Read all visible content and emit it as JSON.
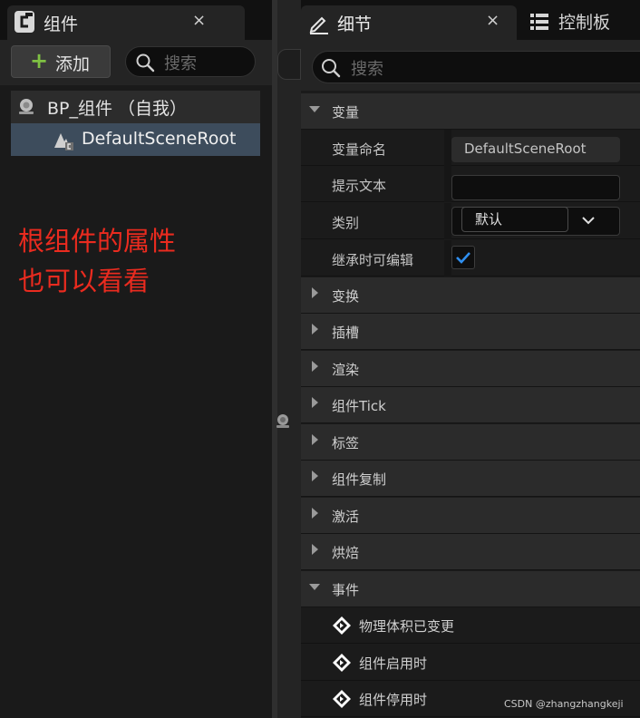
{
  "left_panel": {
    "tab": {
      "title": "组件",
      "close": "×"
    },
    "add_button": {
      "icon": "plus-icon",
      "label": "添加"
    },
    "search": {
      "placeholder": "搜索"
    },
    "tree": {
      "root": {
        "label": "BP_组件 （自我）"
      },
      "child": {
        "label": "DefaultSceneRoot"
      }
    },
    "annotation": {
      "line1": "根组件的属性",
      "line2": "也可以看看",
      "color": "#ea2b1f"
    }
  },
  "details_panel": {
    "tab": {
      "title": "细节",
      "close": "×"
    },
    "dashboard_tab": {
      "title": "控制板"
    },
    "search": {
      "placeholder": "搜索"
    },
    "variables_section": {
      "title": "变量",
      "expanded": true,
      "properties": {
        "variable_name": {
          "label": "变量命名",
          "value": "DefaultSceneRoot"
        },
        "tooltip": {
          "label": "提示文本",
          "value": ""
        },
        "category": {
          "label": "类别",
          "value": "默认"
        },
        "editable_when_inherited": {
          "label": "继承时可编辑",
          "checked": true
        }
      }
    },
    "collapsed_sections": [
      {
        "title": "变换"
      },
      {
        "title": "插槽"
      },
      {
        "title": "渲染"
      },
      {
        "title": "组件Tick"
      },
      {
        "title": "标签"
      },
      {
        "title": "组件复制"
      },
      {
        "title": "激活"
      },
      {
        "title": "烘焙"
      }
    ],
    "events_section": {
      "title": "事件",
      "expanded": true,
      "items": [
        {
          "label": "物理体积已变更"
        },
        {
          "label": "组件启用时"
        },
        {
          "label": "组件停用时"
        }
      ]
    }
  },
  "watermark": "CSDN @zhangzhangkeji",
  "colors": {
    "selection": "#3d4c5c",
    "accent_check": "#2f8ff0",
    "add_plus": "#7fc143"
  }
}
